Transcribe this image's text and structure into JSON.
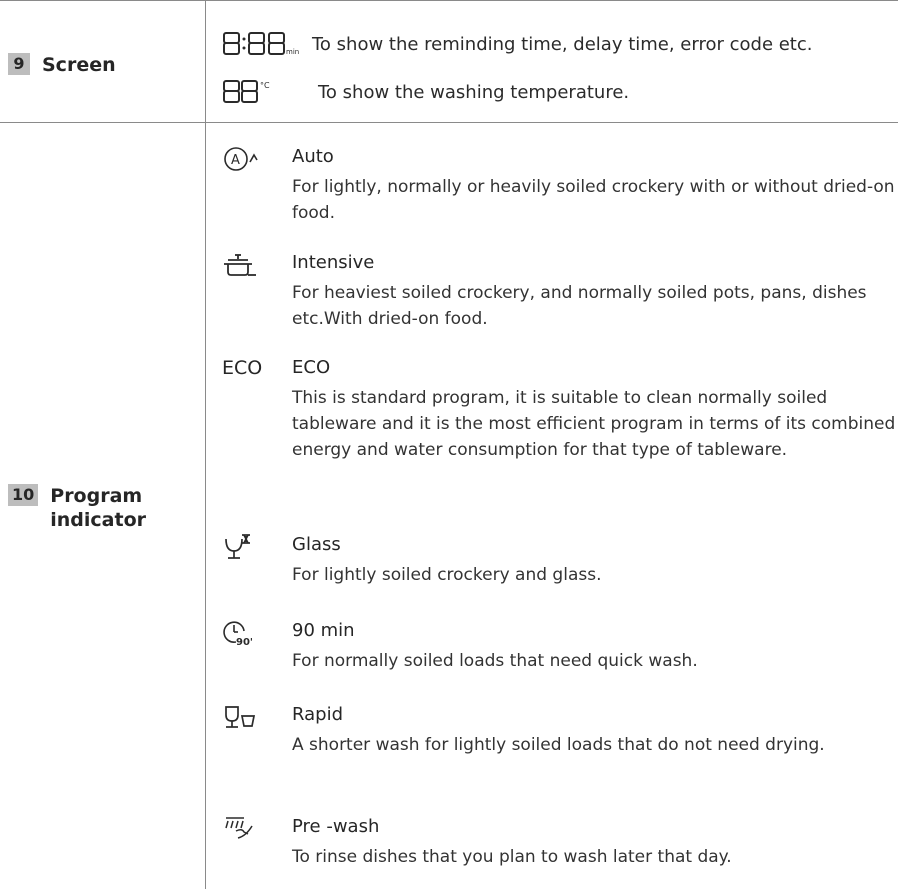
{
  "rows": [
    {
      "number": "9",
      "label": "Screen",
      "items": [
        {
          "icon": "digit-display-8-88-min",
          "display": "8:88",
          "unit": "min",
          "text": "To show the reminding time, delay time, error code etc."
        },
        {
          "icon": "digit-display-88-celsius",
          "display": "88",
          "unit": "°C",
          "text": "To show the washing temperature."
        }
      ]
    },
    {
      "number": "10",
      "label_line1": "Program",
      "label_line2": "indicator",
      "programs": [
        {
          "icon": "auto-icon",
          "title": "Auto",
          "desc": "For lightly, normally or heavily soiled crockery with or without dried-on food."
        },
        {
          "icon": "pot-icon",
          "title": "Intensive",
          "desc": "For heaviest soiled crockery, and normally soiled pots, pans, dishes etc.With dried-on food."
        },
        {
          "icon": "eco-text-icon",
          "icon_text": "ECO",
          "title": "ECO",
          "desc": "This is standard program, it is suitable to clean normally soiled tableware and it is the most efficient program in terms of its combined energy and water consumption for that type of tableware."
        },
        {
          "icon": "glass-icon",
          "title": "Glass",
          "desc": "For lightly soiled crockery and glass."
        },
        {
          "icon": "clock-90-icon",
          "icon_text": "90'",
          "title": "90 min",
          "desc": "For normally soiled loads that need quick wash."
        },
        {
          "icon": "rapid-glass-cup-icon",
          "title": "Rapid",
          "desc": "A shorter wash for lightly soiled loads that do not need drying."
        },
        {
          "icon": "prewash-spray-icon",
          "title": "Pre -wash",
          "desc": "To rinse dishes that you plan to wash later that day."
        }
      ]
    }
  ]
}
